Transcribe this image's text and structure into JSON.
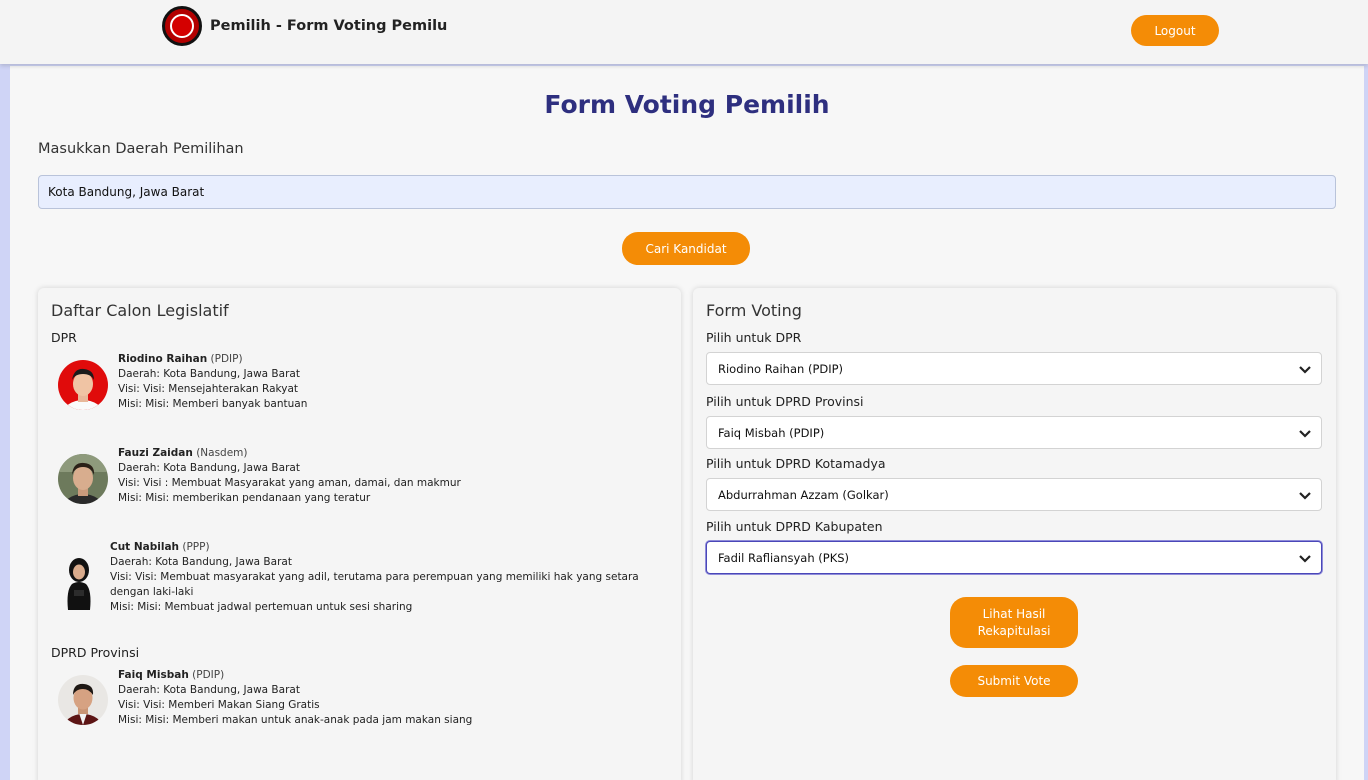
{
  "header": {
    "app_title": "Pemilih - Form Voting Pemilu",
    "logout_label": "Logout"
  },
  "main": {
    "page_title": "Form Voting Pemilih",
    "region_label": "Masukkan Daerah Pemilihan",
    "region_value": "Kota Bandung, Jawa Barat",
    "search_label": "Cari Kandidat"
  },
  "candidates_panel": {
    "title": "Daftar Calon Legislatif",
    "sections": [
      {
        "heading": "DPR",
        "candidates": [
          {
            "name": "Riodino Raihan",
            "party": "(PDIP)",
            "daerah": "Daerah: Kota Bandung, Jawa Barat",
            "visi": "Visi: Visi: Mensejahterakan Rakyat",
            "misi": "Misi: Misi: Memberi banyak bantuan"
          },
          {
            "name": "Fauzi Zaidan",
            "party": "(Nasdem)",
            "daerah": "Daerah: Kota Bandung, Jawa Barat",
            "visi": "Visi: Visi : Membuat Masyarakat yang aman, damai, dan makmur",
            "misi": "Misi: Misi: memberikan pendanaan yang teratur"
          },
          {
            "name": "Cut Nabilah",
            "party": "(PPP)",
            "daerah": "Daerah: Kota Bandung, Jawa Barat",
            "visi_line1": "Visi: Visi: Membuat masyarakat yang adil, terutama para perempuan yang memiliki hak yang setara",
            "visi_line2": "dengan laki-laki",
            "misi": "Misi: Misi: Membuat jadwal pertemuan untuk sesi sharing"
          }
        ]
      },
      {
        "heading": "DPRD Provinsi",
        "candidates": [
          {
            "name": "Faiq Misbah",
            "party": "(PDIP)",
            "daerah": "Daerah: Kota Bandung, Jawa Barat",
            "visi": "Visi: Visi: Memberi Makan Siang Gratis",
            "misi": "Misi: Misi: Memberi makan untuk anak-anak pada jam makan siang"
          }
        ]
      }
    ]
  },
  "voting_panel": {
    "title": "Form Voting",
    "fields": [
      {
        "label": "Pilih untuk DPR",
        "selected": "Riodino Raihan (PDIP)"
      },
      {
        "label": "Pilih untuk DPRD Provinsi",
        "selected": "Faiq Misbah (PDIP)"
      },
      {
        "label": "Pilih untuk DPRD Kotamadya",
        "selected": "Abdurrahman Azzam (Golkar)"
      },
      {
        "label": "Pilih untuk DPRD Kabupaten",
        "selected": "Fadil Rafliansyah (PKS)"
      }
    ],
    "recap_line1": "Lihat Hasil",
    "recap_line2": "Rekapitulasi",
    "submit_label": "Submit Vote"
  },
  "colors": {
    "accent": "#f48c06",
    "title": "#2e2f7f",
    "input_bg": "#e8eefe",
    "page_edge": "#cfd4f6"
  }
}
